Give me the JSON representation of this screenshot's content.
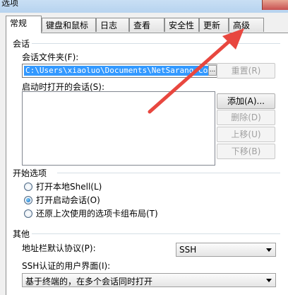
{
  "window": {
    "title": "选项"
  },
  "tabs": [
    "常规",
    "键盘和鼠标",
    "日志",
    "查看",
    "安全性",
    "更新",
    "高级"
  ],
  "session_section": {
    "heading": "会话",
    "folder_label": "会话文件夹(F):",
    "folder_value": "C:\\Users\\xiaoluo\\Documents\\NetSarang Comp...",
    "browse_label": "...",
    "reset_label": "重置(R)",
    "startup_label": "启动时打开的会话(S):",
    "add_label": "添加(A)...",
    "delete_label": "删除(D)",
    "up_label": "上移(U)",
    "down_label": "下移(B)"
  },
  "startup_options": {
    "heading": "开始选项",
    "options": [
      {
        "label": "打开本地Shell(L)",
        "selected": false
      },
      {
        "label": "打开启动会话(O)",
        "selected": true
      },
      {
        "label": "还原上次使用的选项卡组布局(T)",
        "selected": false
      }
    ]
  },
  "other": {
    "heading": "其他",
    "address_protocol_label": "地址栏默认协议(P):",
    "address_protocol_value": "SSH",
    "ssh_ui_label": "SSH认证的用户界面(I):",
    "ssh_ui_value": "基于终端的，在多个会话同时打开"
  },
  "colors": {
    "annotation_arrow": "#e8473f",
    "selection": "#3399ff"
  }
}
